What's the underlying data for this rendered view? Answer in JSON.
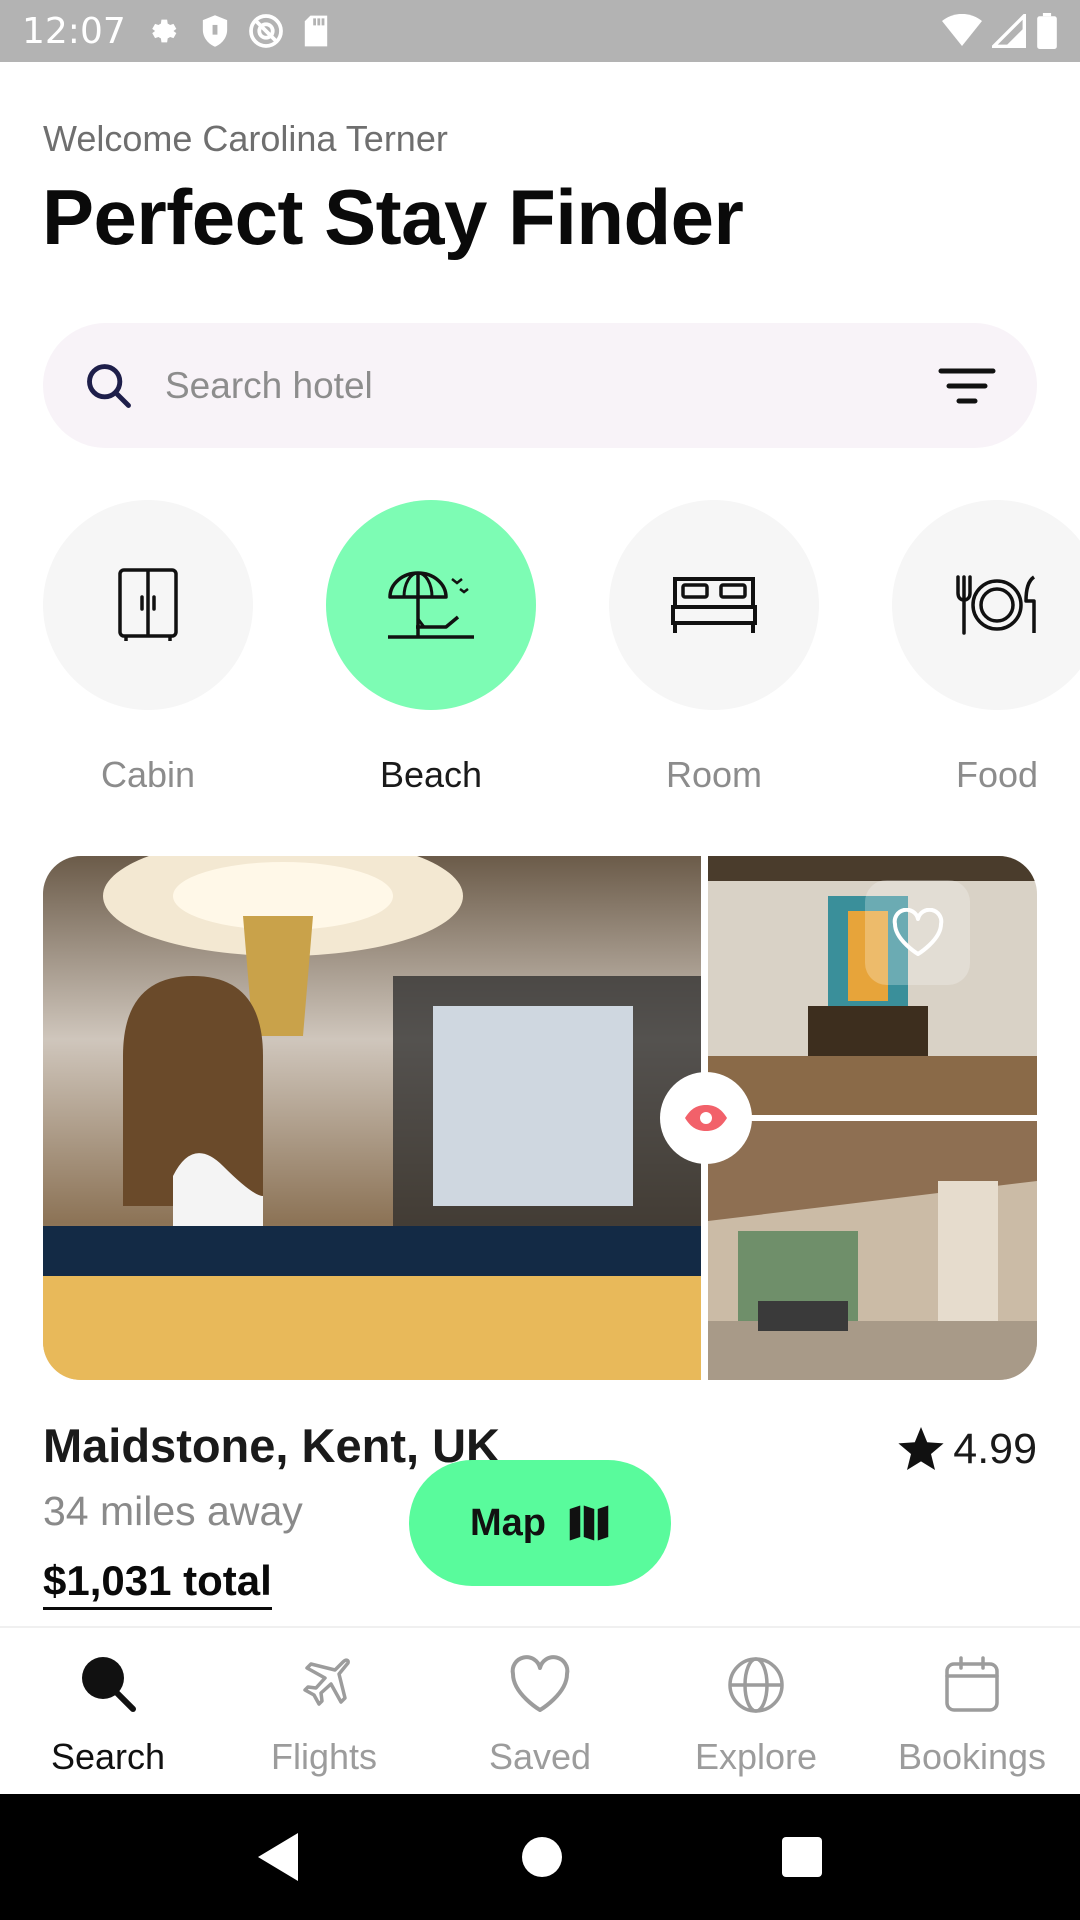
{
  "status_bar": {
    "time": "12:07",
    "left_icons": [
      "settings-icon",
      "shield-icon",
      "do-not-disturb-icon",
      "sd-card-icon"
    ],
    "right_icons": [
      "wifi-icon",
      "signal-icon",
      "battery-icon"
    ]
  },
  "header": {
    "welcome": "Welcome Carolina Terner",
    "title": "Perfect Stay Finder"
  },
  "search": {
    "placeholder": "Search hotel",
    "value": ""
  },
  "categories": [
    {
      "label": "Cabin",
      "icon": "cabinet-icon",
      "active": false
    },
    {
      "label": "Beach",
      "icon": "beach-umbrella-icon",
      "active": true
    },
    {
      "label": "Room",
      "icon": "bed-icon",
      "active": false
    },
    {
      "label": "Food",
      "icon": "plate-cutlery-icon",
      "active": false
    }
  ],
  "listing": {
    "location": "Maidstone, Kent, UK",
    "distance": "34 miles away",
    "price": "$1,031 total",
    "rating": "4.99"
  },
  "map_button": {
    "label": "Map"
  },
  "bottom_nav": [
    {
      "label": "Search",
      "icon": "search-icon",
      "active": true
    },
    {
      "label": "Flights",
      "icon": "airplane-icon",
      "active": false
    },
    {
      "label": "Saved",
      "icon": "heart-icon",
      "active": false
    },
    {
      "label": "Explore",
      "icon": "globe-icon",
      "active": false
    },
    {
      "label": "Bookings",
      "icon": "calendar-icon",
      "active": false
    }
  ],
  "colors": {
    "accent": "#59fb9c",
    "accent_light": "#7dfcb4",
    "search_bg": "#f8f3f8",
    "eye_icon": "#f2616a"
  }
}
